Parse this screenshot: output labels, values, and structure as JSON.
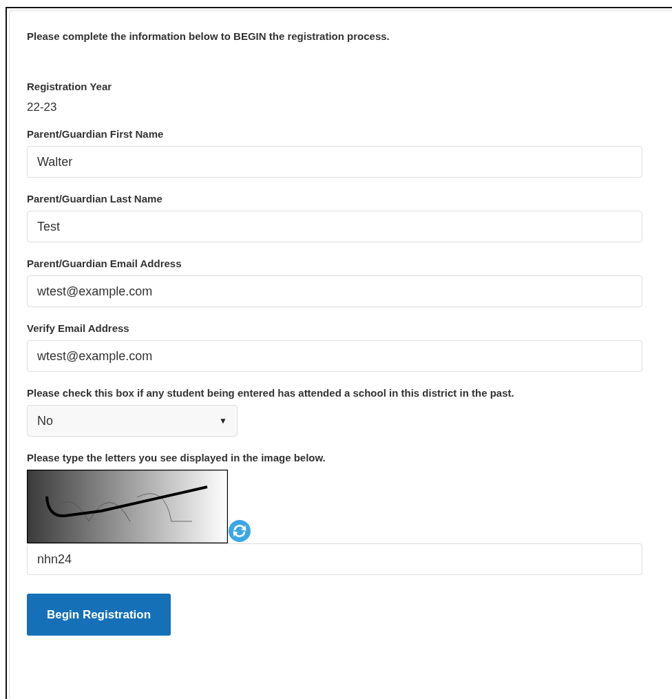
{
  "intro": "Please complete the information below to BEGIN the registration process.",
  "registration_year": {
    "label": "Registration Year",
    "value": "22-23"
  },
  "fields": [
    {
      "label": "Parent/Guardian First Name",
      "value": "Walter"
    },
    {
      "label": "Parent/Guardian Last Name",
      "value": "Test"
    },
    {
      "label": "Parent/Guardian Email Address",
      "value": "wtest@example.com"
    },
    {
      "label": "Verify Email Address",
      "value": "wtest@example.com"
    }
  ],
  "past_attendance": {
    "label": "Please check this box if any student being entered has attended a school in this district in the past.",
    "value": "No",
    "arrow": "▼"
  },
  "captcha": {
    "label": "Please type the letters you see displayed in the image below.",
    "value": "nhn24"
  },
  "submit_button": "Begin Registration"
}
